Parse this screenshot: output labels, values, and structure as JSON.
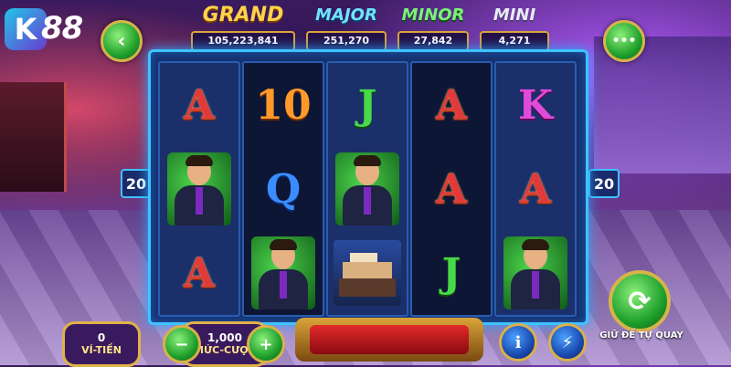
{
  "logo": {
    "mark": "K",
    "text": "88"
  },
  "nav": {
    "back_icon": "‹",
    "menu_icon": "•••"
  },
  "jackpots": [
    {
      "name": "GRAND",
      "value": "105,223,841"
    },
    {
      "name": "MAJOR",
      "value": "251,270"
    },
    {
      "name": "MINOR",
      "value": "27,842"
    },
    {
      "name": "MINI",
      "value": "4,271"
    }
  ],
  "reels": {
    "lines_left": "20",
    "lines_right": "20",
    "symbols": [
      [
        "A",
        "man",
        "A"
      ],
      [
        "10",
        "Q",
        "man"
      ],
      [
        "J",
        "man",
        "house"
      ],
      [
        "A",
        "A",
        "J"
      ],
      [
        "K",
        "A",
        "man"
      ]
    ]
  },
  "controls": {
    "wallet_value": "0",
    "wallet_label": "VÍ-TIỀN",
    "bet_value": "1,000",
    "bet_label": "MỨC-CƯỢC",
    "minus": "−",
    "plus": "+",
    "info": "i",
    "turbo": "⚡",
    "autospin_label": "GIỮ ĐỂ TỰ QUAY"
  }
}
